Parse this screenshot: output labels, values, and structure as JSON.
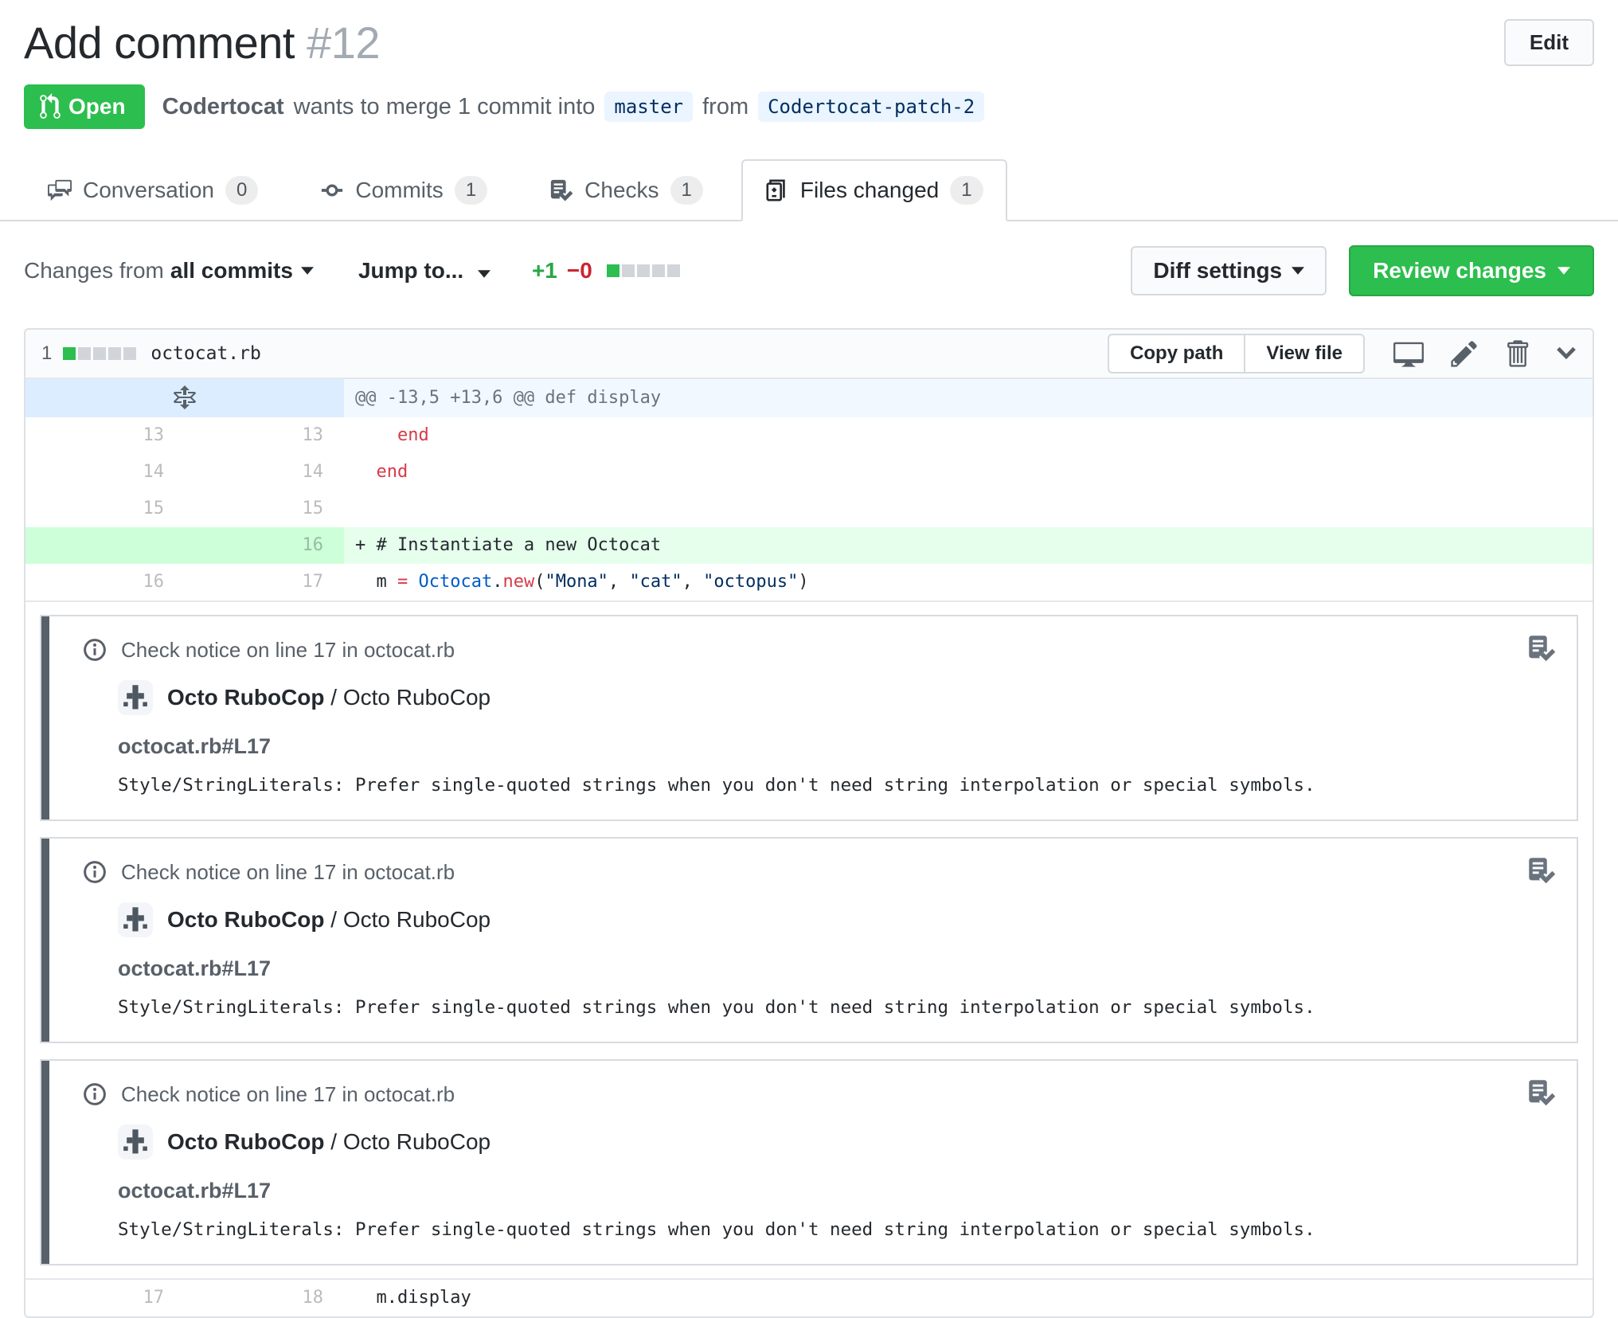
{
  "header": {
    "title": "Add comment",
    "number": "#12",
    "edit_button": "Edit",
    "state_badge": "Open",
    "byline": {
      "author": "Codertocat",
      "middle": "wants to merge 1 commit into",
      "base_branch": "master",
      "from_word": "from",
      "head_branch": "Codertocat-patch-2"
    }
  },
  "tabs": [
    {
      "label": "Conversation",
      "count": "0",
      "icon": "comment-discussion-icon"
    },
    {
      "label": "Commits",
      "count": "1",
      "icon": "git-commit-icon"
    },
    {
      "label": "Checks",
      "count": "1",
      "icon": "checklist-icon"
    },
    {
      "label": "Files changed",
      "count": "1",
      "icon": "file-diff-icon"
    }
  ],
  "toolbar": {
    "changes_from_label": "Changes from",
    "changes_from_value": "all commits",
    "jump_to_label": "Jump to...",
    "additions": "+1",
    "deletions": "−0",
    "diffstat_blocks": {
      "green": 1,
      "gray": 4
    },
    "diff_settings_label": "Diff settings",
    "review_changes_label": "Review changes"
  },
  "file": {
    "stat_count": "1",
    "diffstat_blocks": {
      "green": 1,
      "gray": 4
    },
    "name": "octocat.rb",
    "copy_path_label": "Copy path",
    "view_file_label": "View file",
    "action_icons": [
      "device-desktop-icon",
      "pencil-icon",
      "trashcan-icon",
      "chevron-down-icon"
    ]
  },
  "diff": {
    "hunk_header": "@@ -13,5 +13,6 @@ def display",
    "rows": [
      {
        "old": "13",
        "new": "13",
        "tokens": [
          {
            "t": "    ",
            "k": "plain"
          },
          {
            "t": "end",
            "k": "keyword"
          }
        ]
      },
      {
        "old": "14",
        "new": "14",
        "tokens": [
          {
            "t": "  ",
            "k": "plain"
          },
          {
            "t": "end",
            "k": "keyword"
          }
        ]
      },
      {
        "old": "15",
        "new": "15",
        "tokens": []
      },
      {
        "old": "",
        "new": "16",
        "added": true,
        "tokens": [
          {
            "t": "+ ",
            "k": "plain"
          },
          {
            "t": "# Instantiate a new Octocat",
            "k": "comment"
          }
        ]
      },
      {
        "old": "16",
        "new": "17",
        "tokens": [
          {
            "t": "  m ",
            "k": "plain"
          },
          {
            "t": "=",
            "k": "keyword"
          },
          {
            "t": " ",
            "k": "plain"
          },
          {
            "t": "Octocat",
            "k": "const"
          },
          {
            "t": ".",
            "k": "plain"
          },
          {
            "t": "new",
            "k": "keyword"
          },
          {
            "t": "(",
            "k": "plain"
          },
          {
            "t": "\"Mona\"",
            "k": "string"
          },
          {
            "t": ", ",
            "k": "plain"
          },
          {
            "t": "\"cat\"",
            "k": "string"
          },
          {
            "t": ", ",
            "k": "plain"
          },
          {
            "t": "\"octopus\"",
            "k": "string"
          },
          {
            "t": ")",
            "k": "plain"
          }
        ]
      },
      {
        "old": "17",
        "new": "18",
        "tokens": [
          {
            "t": "  m.display",
            "k": "plain"
          }
        ]
      }
    ]
  },
  "annotation": {
    "header": "Check notice on line 17 in octocat.rb",
    "app_name": "Octo RuboCop",
    "separator": " / ",
    "check_name": "Octo RuboCop",
    "path_line": "octocat.rb#L17",
    "message": "Style/StringLiterals: Prefer single-quoted strings when you don't need string interpolation or special symbols.",
    "count": 3,
    "icons": [
      "info-icon",
      "rubocop-app-icon",
      "checklist-icon"
    ]
  },
  "colors": {
    "open_green": "#2cbe4e",
    "additions_text": "#28a745",
    "deletions_text": "#cb2431",
    "added_line_bg": "#e6ffed",
    "added_gutter_bg": "#cdffd8",
    "hunk_bg": "#f1f8ff",
    "hunk_gutter_bg": "#dbedff",
    "branch_label_bg": "#eaf5ff",
    "branch_label_text": "#032f62",
    "syntax_keyword": "#d73a49",
    "syntax_constant": "#005cc5",
    "syntax_string": "#032f62",
    "annotation_accent_bar": "#586069"
  }
}
